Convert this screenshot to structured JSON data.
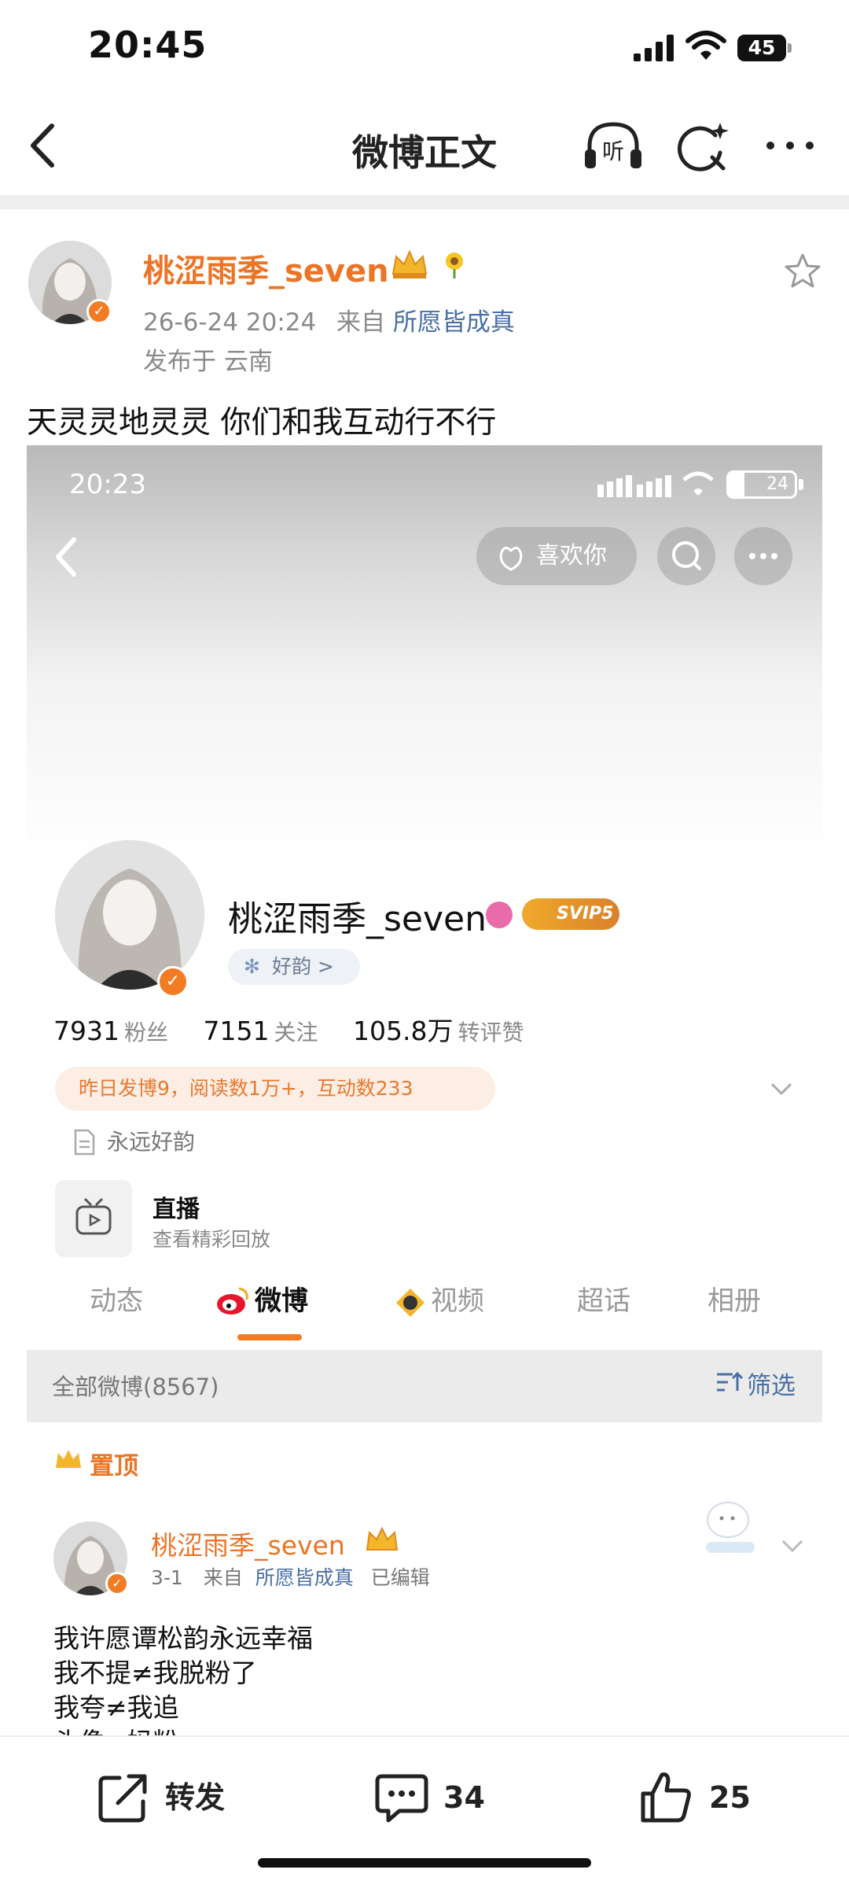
{
  "status_bar": {
    "time": "20:45",
    "battery": "45"
  },
  "header": {
    "title": "微博正文",
    "listen_label": "听"
  },
  "post": {
    "author": "桃涩雨季_seven",
    "date": "26-6-24 20:24",
    "from_prefix": "来自",
    "source": "所愿皆成真",
    "location": "发布于 云南",
    "text": "天灵灵地灵灵 你们和我互动行不行"
  },
  "screenshot": {
    "status_time": "20:23",
    "battery": "24",
    "like_button": "喜欢你",
    "profile": {
      "name": "桃涩雨季_seven",
      "svip": "SVIP5",
      "group_tag": "好韵 >",
      "followers_count": "7931",
      "followers_label": "粉丝",
      "following_count": "7151",
      "following_label": "关注",
      "interactions_count": "105.8万",
      "interactions_label": "转评赞",
      "yesterday_stats": "昨日发博9，阅读数1万+，互动数233",
      "description": "永远好韵",
      "live_title": "直播",
      "live_subtitle": "查看精彩回放"
    },
    "tabs": [
      {
        "label": "动态"
      },
      {
        "label": "微博"
      },
      {
        "label": "视频"
      },
      {
        "label": "超话"
      },
      {
        "label": "相册"
      }
    ],
    "all_posts": "全部微博(8567)",
    "filter": "筛选",
    "pinned": "置顶",
    "pinned_post": {
      "author": "桃涩雨季_seven",
      "date": "3-1",
      "from_prefix": "来自",
      "source": "所愿皆成真",
      "edited": "已编辑",
      "lines": [
        "我许愿谭松韵永远幸福",
        "我不提≠我脱粉了",
        "我夸≠我追",
        "头像≠妈粉"
      ]
    }
  },
  "actions": {
    "repost_label": "转发",
    "comments_count": "34",
    "likes_count": "25"
  },
  "colors": {
    "accent": "#eb7425",
    "link": "#4a6fa5"
  }
}
